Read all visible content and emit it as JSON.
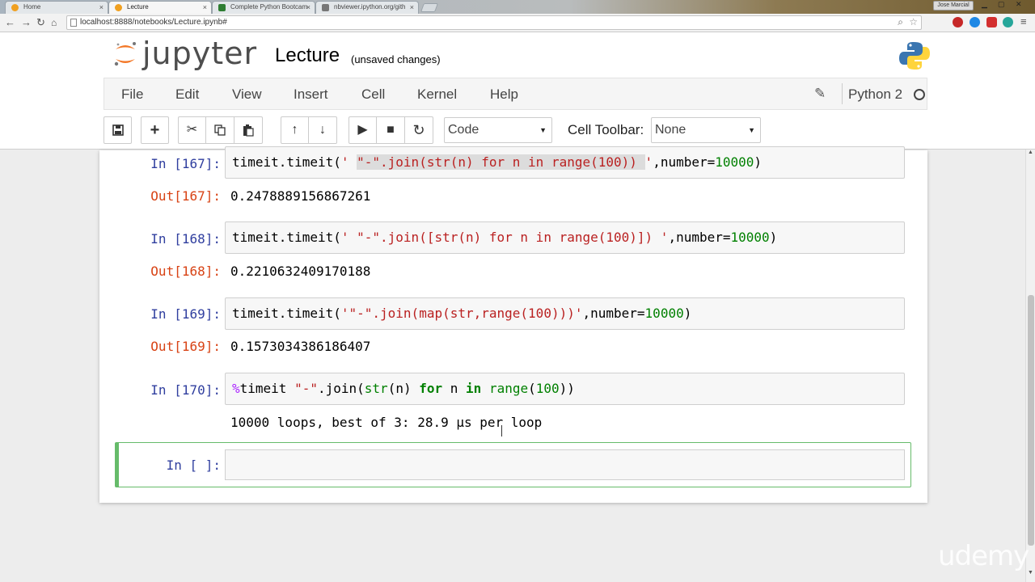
{
  "browser": {
    "tabs": [
      {
        "title": "Home",
        "color": "#f0a020"
      },
      {
        "title": "Lecture",
        "color": "#f0a020"
      },
      {
        "title": "Complete Python Bootcam",
        "color": "#2e7d32"
      },
      {
        "title": "nbviewer.ipython.org/gith",
        "color": "#777777"
      }
    ],
    "tab_close": "×",
    "user": "Jose Marcial",
    "url": "localhost:8888/notebooks/Lecture.ipynb#"
  },
  "header": {
    "logo": "jupyter",
    "notebook_name": "Lecture",
    "save_status": "(unsaved changes)"
  },
  "menu": {
    "items": [
      "File",
      "Edit",
      "View",
      "Insert",
      "Cell",
      "Kernel",
      "Help"
    ],
    "kernel": "Python 2"
  },
  "toolbar": {
    "cell_type": "Code",
    "cell_toolbar_label": "Cell Toolbar:",
    "cell_toolbar_value": "None"
  },
  "cells": [
    {
      "in_prompt": "In [167]:",
      "out_prompt": "Out[167]:",
      "output": "0.2478889156867261"
    },
    {
      "in_prompt": "In [168]:",
      "out_prompt": "Out[168]:",
      "output": "0.2210632409170188"
    },
    {
      "in_prompt": "In [169]:",
      "out_prompt": "Out[169]:",
      "output": "0.1573034386186407"
    },
    {
      "in_prompt": "In [170]:",
      "output": "10000 loops, best of 3: 28.9 µs per loop"
    },
    {
      "in_prompt": "In [ ]:"
    }
  ],
  "watermark": "udemy"
}
